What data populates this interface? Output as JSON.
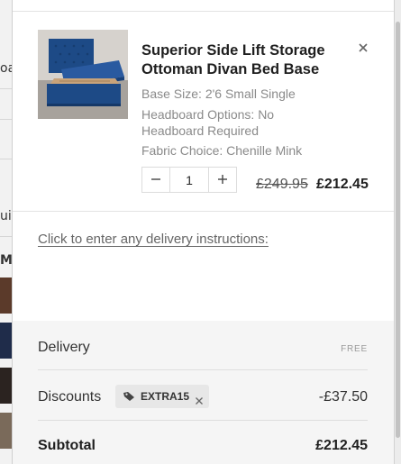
{
  "background_page": {
    "fragments": [
      "oa",
      "uir",
      "M"
    ]
  },
  "cart_item": {
    "title": "Superior Side Lift Storage Ottoman Divan Bed Base",
    "image_alt": "Blue ottoman divan bed with lifted storage base",
    "options": [
      "Base Size: 2'6 Small Single",
      "Headboard Options: No",
      "Headboard Required",
      "Fabric Choice: Chenille Mink"
    ],
    "quantity": "1",
    "price_original": "£249.95",
    "price_current": "£212.45",
    "remove_icon": "close-icon",
    "decrement_icon": "minus-icon",
    "increment_icon": "plus-icon"
  },
  "delivery_instructions_link": "Click to enter any delivery instructions:",
  "summary": {
    "delivery_label": "Delivery",
    "delivery_value": "FREE",
    "discounts_label": "Discounts",
    "discount_code": "EXTRA15",
    "discount_icon": "tag-icon",
    "discount_value": "-£37.50",
    "subtotal_label": "Subtotal",
    "subtotal_value": "£212.45"
  },
  "colors": {
    "accent_bed_blue": "#1d4a86",
    "text_dark": "#1f1f1f",
    "text_muted": "#8a8a8a",
    "summary_bg": "#f5f5f5"
  }
}
